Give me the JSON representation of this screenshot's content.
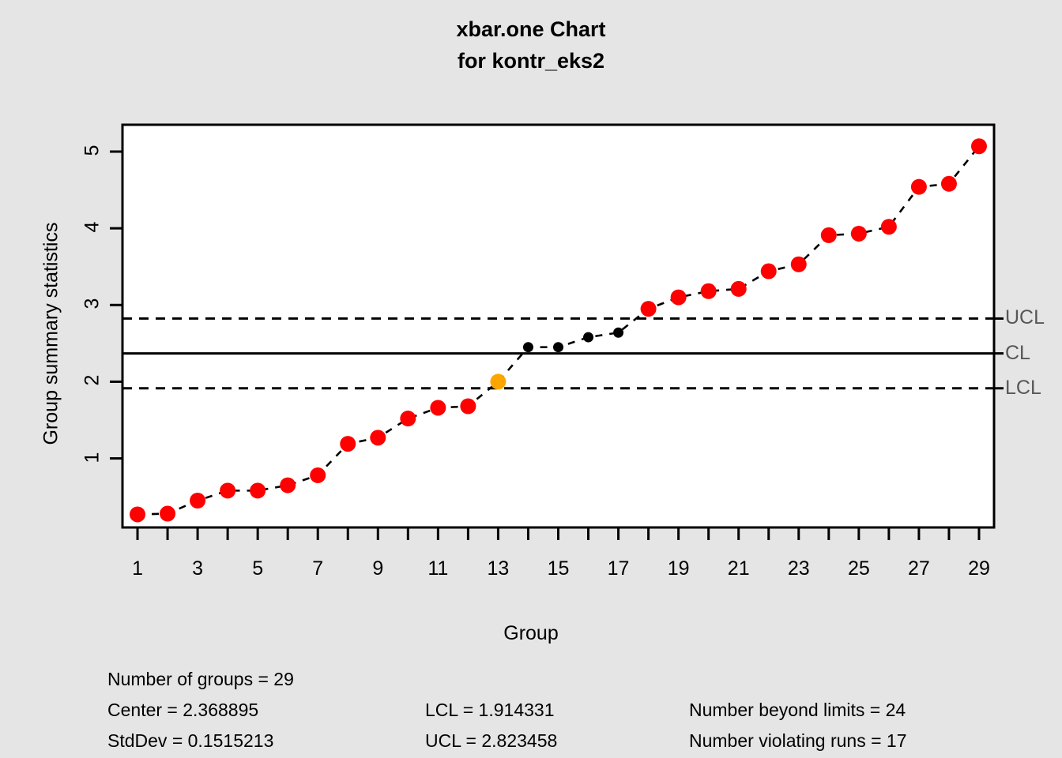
{
  "title": {
    "line1": "xbar.one Chart",
    "line2": "for kontr_eks2"
  },
  "axes": {
    "ylabel": "Group summary statistics",
    "xlabel": "Group"
  },
  "limit_labels": {
    "ucl": "UCL",
    "cl": "CL",
    "lcl": "LCL"
  },
  "stats": {
    "num_groups": "Number of groups = 29",
    "center": "Center = 2.368895",
    "stddev": "StdDev = 0.1515213",
    "lcl": "LCL = 1.914331",
    "ucl": "UCL = 2.823458",
    "beyond": "Number beyond limits = 24",
    "runs": "Number violating runs = 17"
  },
  "colors": {
    "background": "#e5e5e5",
    "panel": "#ffffff",
    "violation_point": "#ff0000",
    "run_point": "#ffa500",
    "normal_point": "#000000",
    "line": "#000000",
    "limit_label": "#575757"
  },
  "chart_data": {
    "type": "line",
    "title": "xbar.one Chart for kontr_eks2",
    "xlabel": "Group",
    "ylabel": "Group summary statistics",
    "xlim": [
      0.5,
      29.5
    ],
    "ylim": [
      0.1,
      5.35
    ],
    "yticks": [
      1,
      2,
      3,
      4,
      5
    ],
    "xticks": [
      1,
      2,
      3,
      4,
      5,
      6,
      7,
      8,
      9,
      10,
      11,
      12,
      13,
      14,
      15,
      16,
      17,
      18,
      19,
      20,
      21,
      22,
      23,
      24,
      25,
      26,
      27,
      28,
      29
    ],
    "xtick_labels": [
      1,
      3,
      5,
      7,
      9,
      11,
      13,
      15,
      17,
      19,
      21,
      23,
      25,
      27,
      29
    ],
    "grid": false,
    "center_line": 2.368895,
    "lcl": 1.914331,
    "ucl": 2.823458,
    "stddev": 0.1515213,
    "number_of_groups": 29,
    "number_beyond_limits": 24,
    "number_violating_runs": 17,
    "x": [
      1,
      2,
      3,
      4,
      5,
      6,
      7,
      8,
      9,
      10,
      11,
      12,
      13,
      14,
      15,
      16,
      17,
      18,
      19,
      20,
      21,
      22,
      23,
      24,
      25,
      26,
      27,
      28,
      29
    ],
    "values": [
      0.27,
      0.28,
      0.45,
      0.58,
      0.58,
      0.65,
      0.78,
      1.19,
      1.27,
      1.52,
      1.66,
      1.68,
      2.0,
      2.45,
      2.45,
      2.58,
      2.64,
      2.95,
      3.1,
      3.18,
      3.21,
      3.44,
      3.53,
      3.91,
      3.93,
      4.02,
      4.54,
      4.58,
      5.07
    ],
    "point_states": [
      "beyond",
      "beyond",
      "beyond",
      "beyond",
      "beyond",
      "beyond",
      "beyond",
      "beyond",
      "beyond",
      "beyond",
      "beyond",
      "beyond",
      "run",
      "in-control",
      "in-control",
      "in-control",
      "in-control",
      "beyond",
      "beyond",
      "beyond",
      "beyond",
      "beyond",
      "beyond",
      "beyond",
      "beyond",
      "beyond",
      "beyond",
      "beyond",
      "beyond"
    ]
  }
}
